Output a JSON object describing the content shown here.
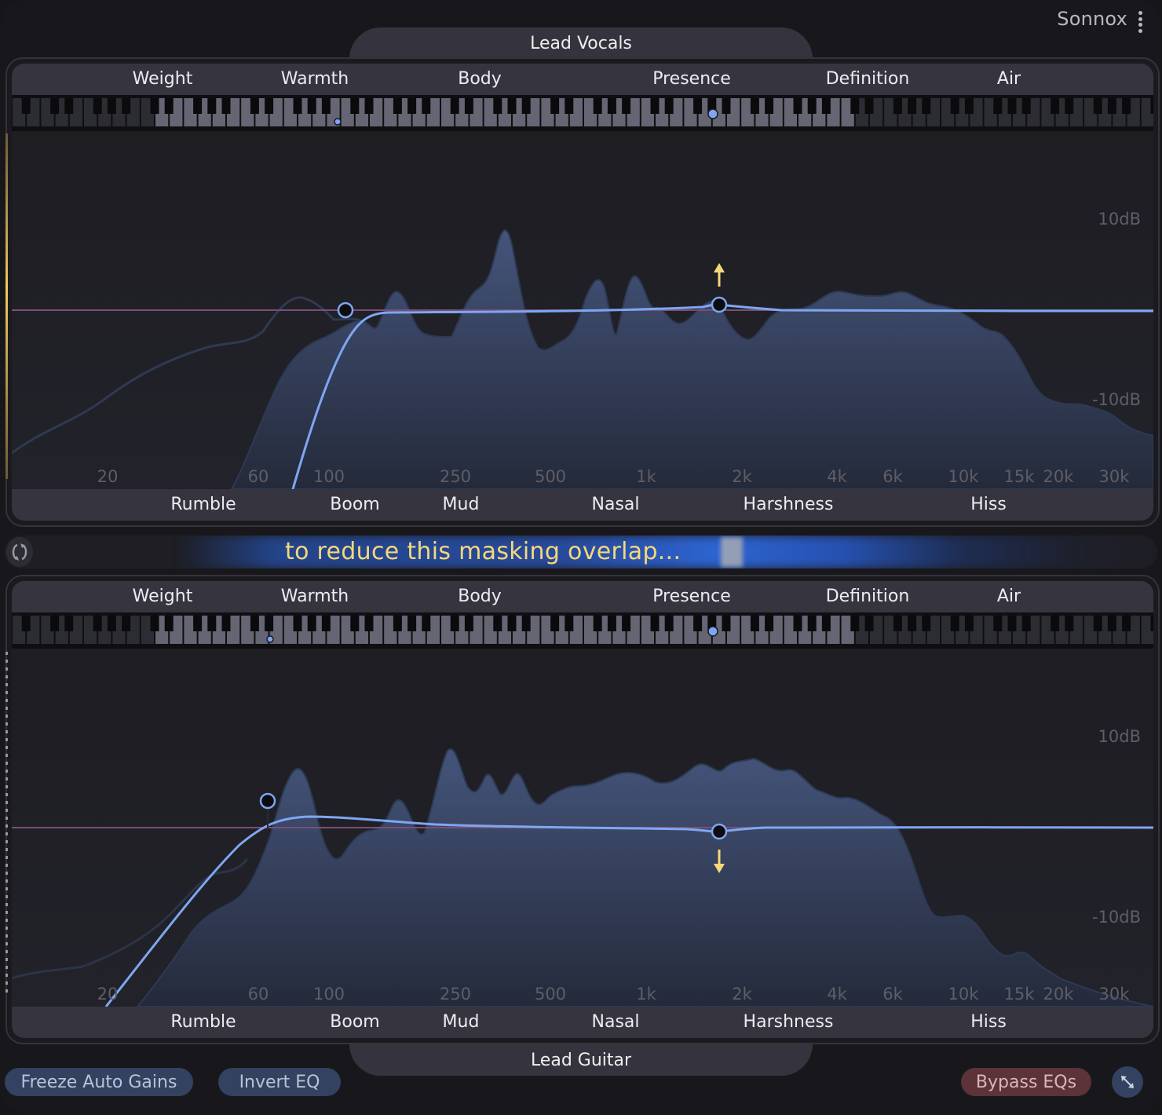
{
  "brand": {
    "name": "Sonnox",
    "menu_icon": "vertical-dots-icon"
  },
  "colors": {
    "accent_blue": "#7fa6f2",
    "spectrum_fill": "#3d4d70",
    "zero_line": "#7a4f78",
    "arrow_yellow": "#f6d87a",
    "mask_text": "#f6d87a",
    "bypass_red": "#5b3338",
    "button_blue": "#334260"
  },
  "tracks": {
    "top": {
      "name": "Lead Vocals",
      "top_bands": [
        {
          "label": "Weight",
          "freq": 35
        },
        {
          "label": "Warmth",
          "freq": 90
        },
        {
          "label": "Body",
          "freq": 220
        },
        {
          "label": "Presence",
          "freq": 1300
        },
        {
          "label": "Definition",
          "freq": 4500
        },
        {
          "label": "Air",
          "freq": 12000
        }
      ],
      "bottom_bands": [
        {
          "label": "Rumble",
          "freq": 45
        },
        {
          "label": "Boom",
          "freq": 100
        },
        {
          "label": "Mud",
          "freq": 250
        },
        {
          "label": "Nasal",
          "freq": 800
        },
        {
          "label": "Harshness",
          "freq": 2500
        },
        {
          "label": "Hiss",
          "freq": 10000
        }
      ],
      "freq_labels": [
        "20",
        "60",
        "100",
        "250",
        "500",
        "1k",
        "2k",
        "4k",
        "6k",
        "10k",
        "15k",
        "20k",
        "30k"
      ],
      "db_labels": [
        "10dB",
        "-10dB"
      ],
      "eq_nodes": [
        {
          "type": "high-pass",
          "freq_hz": 105,
          "gain_db": 0
        },
        {
          "type": "bell",
          "freq_hz": 1850,
          "gain_db": 0.8,
          "direction": "up"
        }
      ],
      "key_markers": [
        {
          "freq_hz": 105,
          "size": "small"
        },
        {
          "freq_hz": 1850,
          "size": "large"
        }
      ]
    },
    "bottom": {
      "name": "Lead Guitar",
      "top_bands": [
        {
          "label": "Weight"
        },
        {
          "label": "Warmth"
        },
        {
          "label": "Body"
        },
        {
          "label": "Presence"
        },
        {
          "label": "Definition"
        },
        {
          "label": "Air"
        }
      ],
      "bottom_bands": [
        {
          "label": "Rumble"
        },
        {
          "label": "Boom"
        },
        {
          "label": "Mud"
        },
        {
          "label": "Nasal"
        },
        {
          "label": "Harshness"
        },
        {
          "label": "Hiss"
        }
      ],
      "freq_labels": [
        "20",
        "60",
        "100",
        "250",
        "500",
        "1k",
        "2k",
        "4k",
        "6k",
        "10k",
        "15k",
        "20k",
        "30k"
      ],
      "db_labels": [
        "10dB",
        "-10dB"
      ],
      "eq_nodes": [
        {
          "type": "high-pass",
          "freq_hz": 65,
          "gain_db": 4.5
        },
        {
          "type": "bell",
          "freq_hz": 1850,
          "gain_db": -0.6,
          "direction": "down"
        }
      ],
      "key_markers": [
        {
          "freq_hz": 65,
          "size": "small"
        },
        {
          "freq_hz": 1850,
          "size": "large"
        }
      ]
    }
  },
  "masking": {
    "message": "to reduce this masking overlap...",
    "cycle_icon": "cycle-arrows-icon"
  },
  "buttons": {
    "freeze": "Freeze Auto Gains",
    "invert": "Invert EQ",
    "bypass": "Bypass EQs",
    "expand_icon": "expand-arrows-icon"
  }
}
